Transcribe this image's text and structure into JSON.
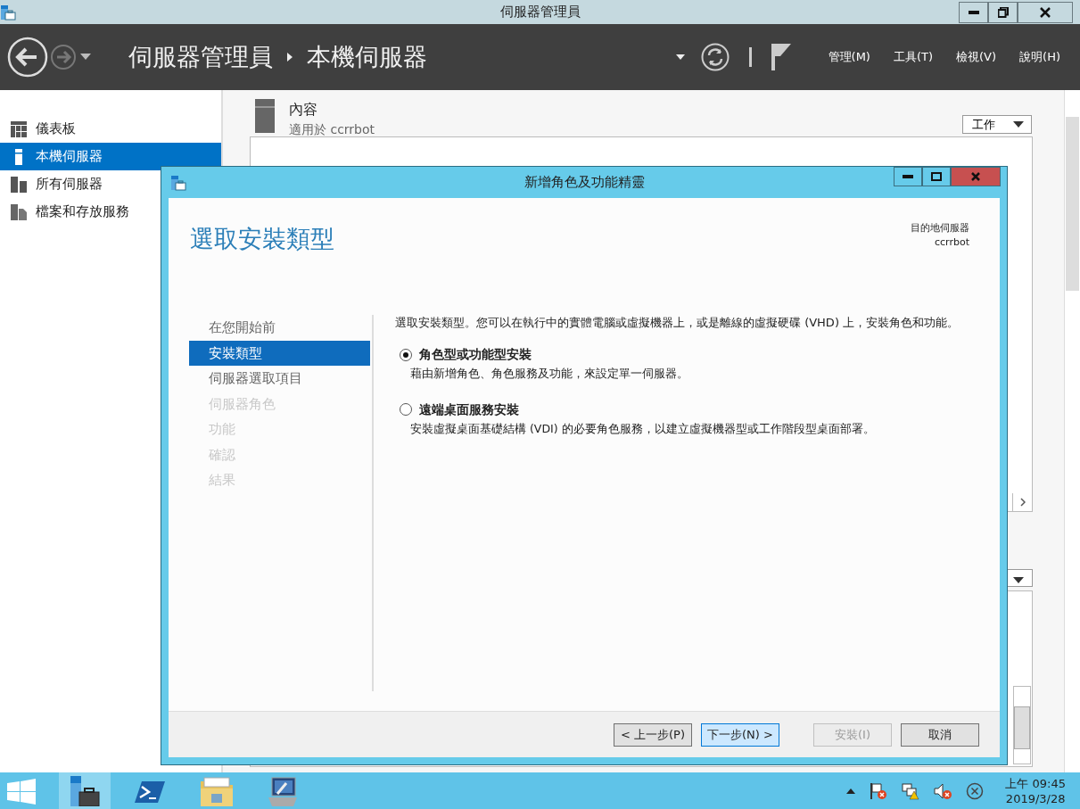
{
  "window": {
    "title": "伺服器管理員"
  },
  "header": {
    "breadcrumb": [
      "伺服器管理員",
      "本機伺服器"
    ],
    "menus": [
      "管理(M)",
      "工具(T)",
      "檢視(V)",
      "說明(H)"
    ]
  },
  "sidebar": {
    "items": [
      {
        "label": "儀表板",
        "selected": false
      },
      {
        "label": "本機伺服器",
        "selected": true
      },
      {
        "label": "所有伺服器",
        "selected": false
      },
      {
        "label": "檔案和存放服務",
        "selected": false
      }
    ]
  },
  "content": {
    "title": "內容",
    "subtitle": "適用於 ccrrbot",
    "tasks_button": "工作"
  },
  "dialog": {
    "title": "新增角色及功能精靈",
    "heading": "選取安裝類型",
    "destination_label": "目的地伺服器",
    "destination_server": "ccrrbot",
    "steps": [
      {
        "label": "在您開始前",
        "selected": false,
        "disabled": false
      },
      {
        "label": "安裝類型",
        "selected": true,
        "disabled": false
      },
      {
        "label": "伺服器選取項目",
        "selected": false,
        "disabled": false
      },
      {
        "label": "伺服器角色",
        "selected": false,
        "disabled": true
      },
      {
        "label": "功能",
        "selected": false,
        "disabled": true
      },
      {
        "label": "確認",
        "selected": false,
        "disabled": true
      },
      {
        "label": "結果",
        "selected": false,
        "disabled": true
      }
    ],
    "description": "選取安裝類型。您可以在執行中的實體電腦或虛擬機器上，或是離線的虛擬硬碟 (VHD) 上，安裝角色和功能。",
    "options": [
      {
        "label": "角色型或功能型安裝",
        "description": "藉由新增角色、角色服務及功能，來設定單一伺服器。",
        "selected": true
      },
      {
        "label": "遠端桌面服務安裝",
        "description": "安裝虛擬桌面基礎結構 (VDI) 的必要角色服務，以建立虛擬機器型或工作階段型桌面部署。",
        "selected": false
      }
    ],
    "buttons": [
      {
        "label": "< 上一步(P)",
        "primary": false,
        "disabled": false
      },
      {
        "label": "下一步(N) >",
        "primary": true,
        "disabled": false
      },
      {
        "label": "安裝(I)",
        "primary": false,
        "disabled": true
      },
      {
        "label": "取消",
        "primary": false,
        "disabled": false
      }
    ]
  },
  "taskbar": {
    "apps": [
      {
        "kind": "server-manager",
        "selected": true
      },
      {
        "kind": "powershell",
        "selected": false
      },
      {
        "kind": "explorer",
        "selected": false
      },
      {
        "kind": "computer",
        "selected": false
      }
    ],
    "clock_time": "上午 09:45",
    "clock_date": "2019/3/28"
  }
}
